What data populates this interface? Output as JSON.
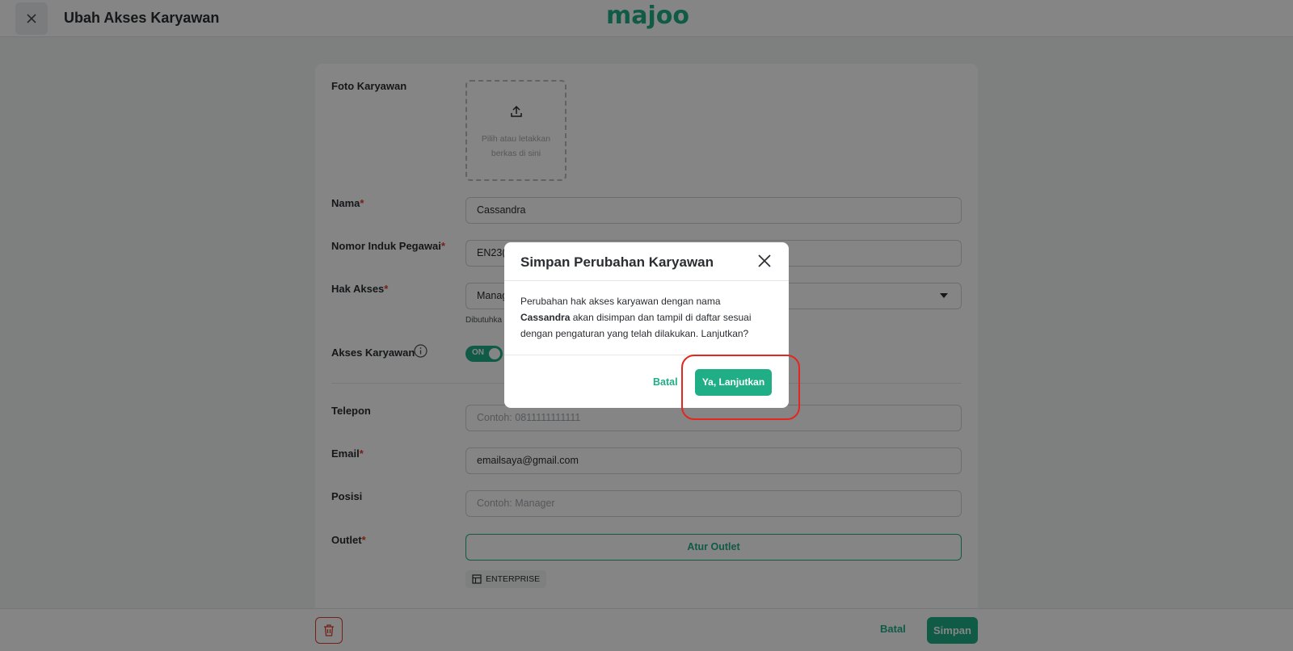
{
  "header": {
    "title": "Ubah Akses Karyawan",
    "logo": "majoo"
  },
  "form": {
    "photo": {
      "label": "Foto Karyawan",
      "upload_text": "Pilih atau letakkan berkas di sini"
    },
    "name": {
      "label": "Nama",
      "value": "Cassandra"
    },
    "employee_id": {
      "label": "Nomor Induk Pegawai",
      "value": "EN23("
    },
    "access": {
      "label": "Hak Akses",
      "value": "Manag",
      "hint": "Dibutuhka"
    },
    "employee_access": {
      "label": "Akses Karyawan",
      "toggle": "ON"
    },
    "phone": {
      "label": "Telepon",
      "placeholder": "Contoh: 0811111111111"
    },
    "email": {
      "label": "Email",
      "value": "emailsaya@gmail.com"
    },
    "position": {
      "label": "Posisi",
      "placeholder": "Contoh: Manager"
    },
    "outlet": {
      "label": "Outlet",
      "button": "Atur Outlet",
      "chip": "ENTERPRISE"
    },
    "required_mark": "*"
  },
  "footer": {
    "cancel": "Batal",
    "save": "Simpan"
  },
  "modal": {
    "title": "Simpan Perubahan Karyawan",
    "body_pre": "Perubahan hak akses karyawan dengan nama",
    "body_name": "Cassandra",
    "body_post": "akan disimpan dan tampil di daftar sesuai dengan pengaturan yang telah dilakukan. Lanjutkan?",
    "cancel": "Batal",
    "confirm": "Ya, Lanjutkan"
  },
  "colors": {
    "brand": "#1fae86",
    "danger": "#e0402d",
    "highlight": "#e5261f"
  }
}
